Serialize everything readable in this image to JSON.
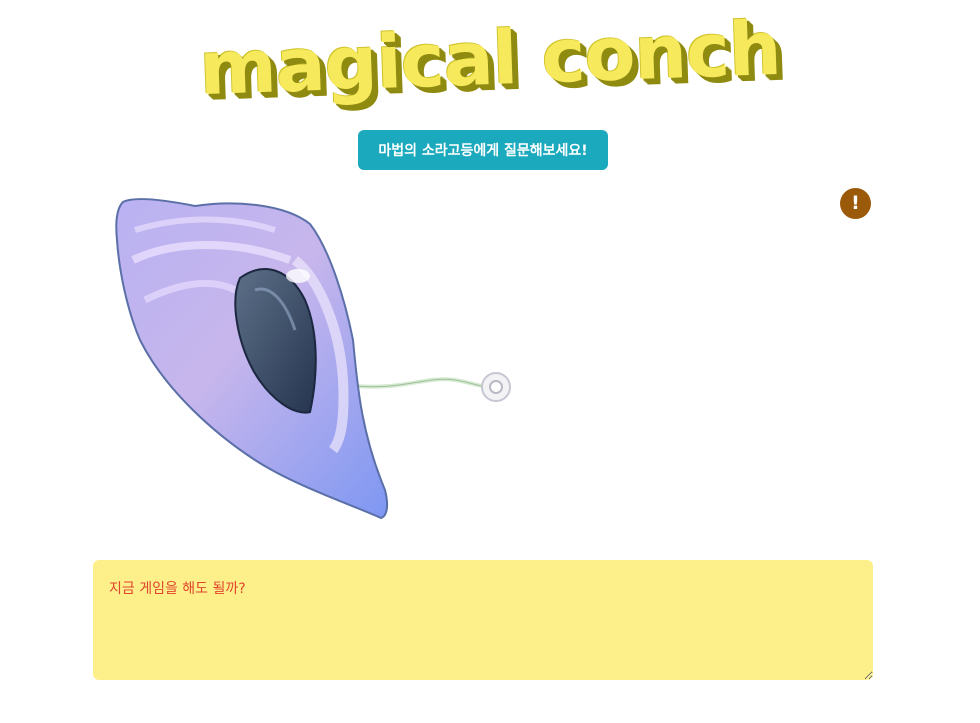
{
  "header": {
    "logo_text": "magical conch"
  },
  "ask_button": {
    "label": "마법의 소라고등에게 질문해보세요!"
  },
  "alert": {
    "symbol": "!",
    "color": "#9a5a09"
  },
  "conch": {
    "icon": "conch-shell-icon"
  },
  "question": {
    "value": "지금 게임을 해도 될까?"
  },
  "colors": {
    "logo_fill": "#f7e95c",
    "logo_shadow": "#8f8a10",
    "button_bg": "#1aa9bd",
    "textarea_bg": "#fdf08a",
    "textarea_text": "#e0452d",
    "shell_light": "#c9b8ee",
    "shell_blue": "#7f8ff0"
  }
}
